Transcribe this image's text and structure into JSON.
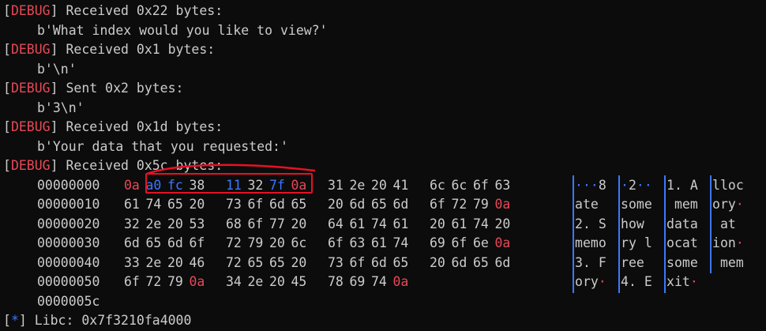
{
  "debug_tag": "DEBUG",
  "info_tag": "*",
  "log": [
    {
      "kind": "debug",
      "text": " Received 0x22 bytes:"
    },
    {
      "kind": "payload",
      "text": "b'What index would you like to view?'"
    },
    {
      "kind": "debug",
      "text": " Received 0x1 bytes:"
    },
    {
      "kind": "payload",
      "text": "b'\\n'"
    },
    {
      "kind": "debug",
      "text": " Sent 0x2 bytes:"
    },
    {
      "kind": "payload",
      "text": "b'3\\n'"
    },
    {
      "kind": "debug",
      "text": " Received 0x1d bytes:"
    },
    {
      "kind": "payload",
      "text": "b'Your data that you requested:'"
    },
    {
      "kind": "debug",
      "text": " Received 0x5c bytes:"
    }
  ],
  "hexdump": [
    {
      "offset": "00000000",
      "bytes": [
        "0a",
        "a0",
        "fc",
        "38",
        "11",
        "32",
        "7f",
        "0a",
        "31",
        "2e",
        "20",
        "41",
        "6c",
        "6c",
        "6f",
        "63"
      ],
      "colors": [
        "r",
        "b",
        "b",
        "",
        "b",
        "",
        "b",
        "r",
        "",
        "",
        "",
        "",
        "",
        "",
        "",
        ""
      ],
      "ascii": [
        [
          "·",
          "··8"
        ],
        [
          "·2··"
        ],
        [
          "1. A"
        ],
        [
          "lloc"
        ]
      ]
    },
    {
      "offset": "00000010",
      "bytes": [
        "61",
        "74",
        "65",
        "20",
        "73",
        "6f",
        "6d",
        "65",
        "20",
        "6d",
        "65",
        "6d",
        "6f",
        "72",
        "79",
        "0a"
      ],
      "colors": [
        "",
        "",
        "",
        "",
        "",
        "",
        "",
        "",
        "",
        "",
        "",
        "",
        "",
        "",
        "",
        "r"
      ],
      "ascii": [
        [
          "ate "
        ],
        [
          "some"
        ],
        [
          " mem"
        ],
        [
          "ory·"
        ]
      ]
    },
    {
      "offset": "00000020",
      "bytes": [
        "32",
        "2e",
        "20",
        "53",
        "68",
        "6f",
        "77",
        "20",
        "64",
        "61",
        "74",
        "61",
        "20",
        "61",
        "74",
        "20"
      ],
      "colors": [
        "",
        "",
        "",
        "",
        "",
        "",
        "",
        "",
        "",
        "",
        "",
        "",
        "",
        "",
        "",
        ""
      ],
      "ascii": [
        [
          "2. S"
        ],
        [
          "how "
        ],
        [
          "data"
        ],
        [
          " at "
        ]
      ]
    },
    {
      "offset": "00000030",
      "bytes": [
        "6d",
        "65",
        "6d",
        "6f",
        "72",
        "79",
        "20",
        "6c",
        "6f",
        "63",
        "61",
        "74",
        "69",
        "6f",
        "6e",
        "0a"
      ],
      "colors": [
        "",
        "",
        "",
        "",
        "",
        "",
        "",
        "",
        "",
        "",
        "",
        "",
        "",
        "",
        "",
        "r"
      ],
      "ascii": [
        [
          "memo"
        ],
        [
          "ry l"
        ],
        [
          "ocat"
        ],
        [
          "ion·"
        ]
      ]
    },
    {
      "offset": "00000040",
      "bytes": [
        "33",
        "2e",
        "20",
        "46",
        "72",
        "65",
        "65",
        "20",
        "73",
        "6f",
        "6d",
        "65",
        "20",
        "6d",
        "65",
        "6d"
      ],
      "colors": [
        "",
        "",
        "",
        "",
        "",
        "",
        "",
        "",
        "",
        "",
        "",
        "",
        "",
        "",
        "",
        ""
      ],
      "ascii": [
        [
          "3. F"
        ],
        [
          "ree "
        ],
        [
          "some"
        ],
        [
          " mem"
        ]
      ]
    },
    {
      "offset": "00000050",
      "bytes": [
        "6f",
        "72",
        "79",
        "0a",
        "34",
        "2e",
        "20",
        "45",
        "78",
        "69",
        "74",
        "0a"
      ],
      "colors": [
        "",
        "",
        "",
        "r",
        "",
        "",
        "",
        "",
        "",
        "",
        "",
        "r"
      ],
      "ascii": [
        [
          "ory·"
        ],
        [
          "4. E"
        ],
        [
          "xit·"
        ]
      ]
    }
  ],
  "end_offset": "0000005c",
  "libc_line": " Libc: 0x7f3210fa4000"
}
